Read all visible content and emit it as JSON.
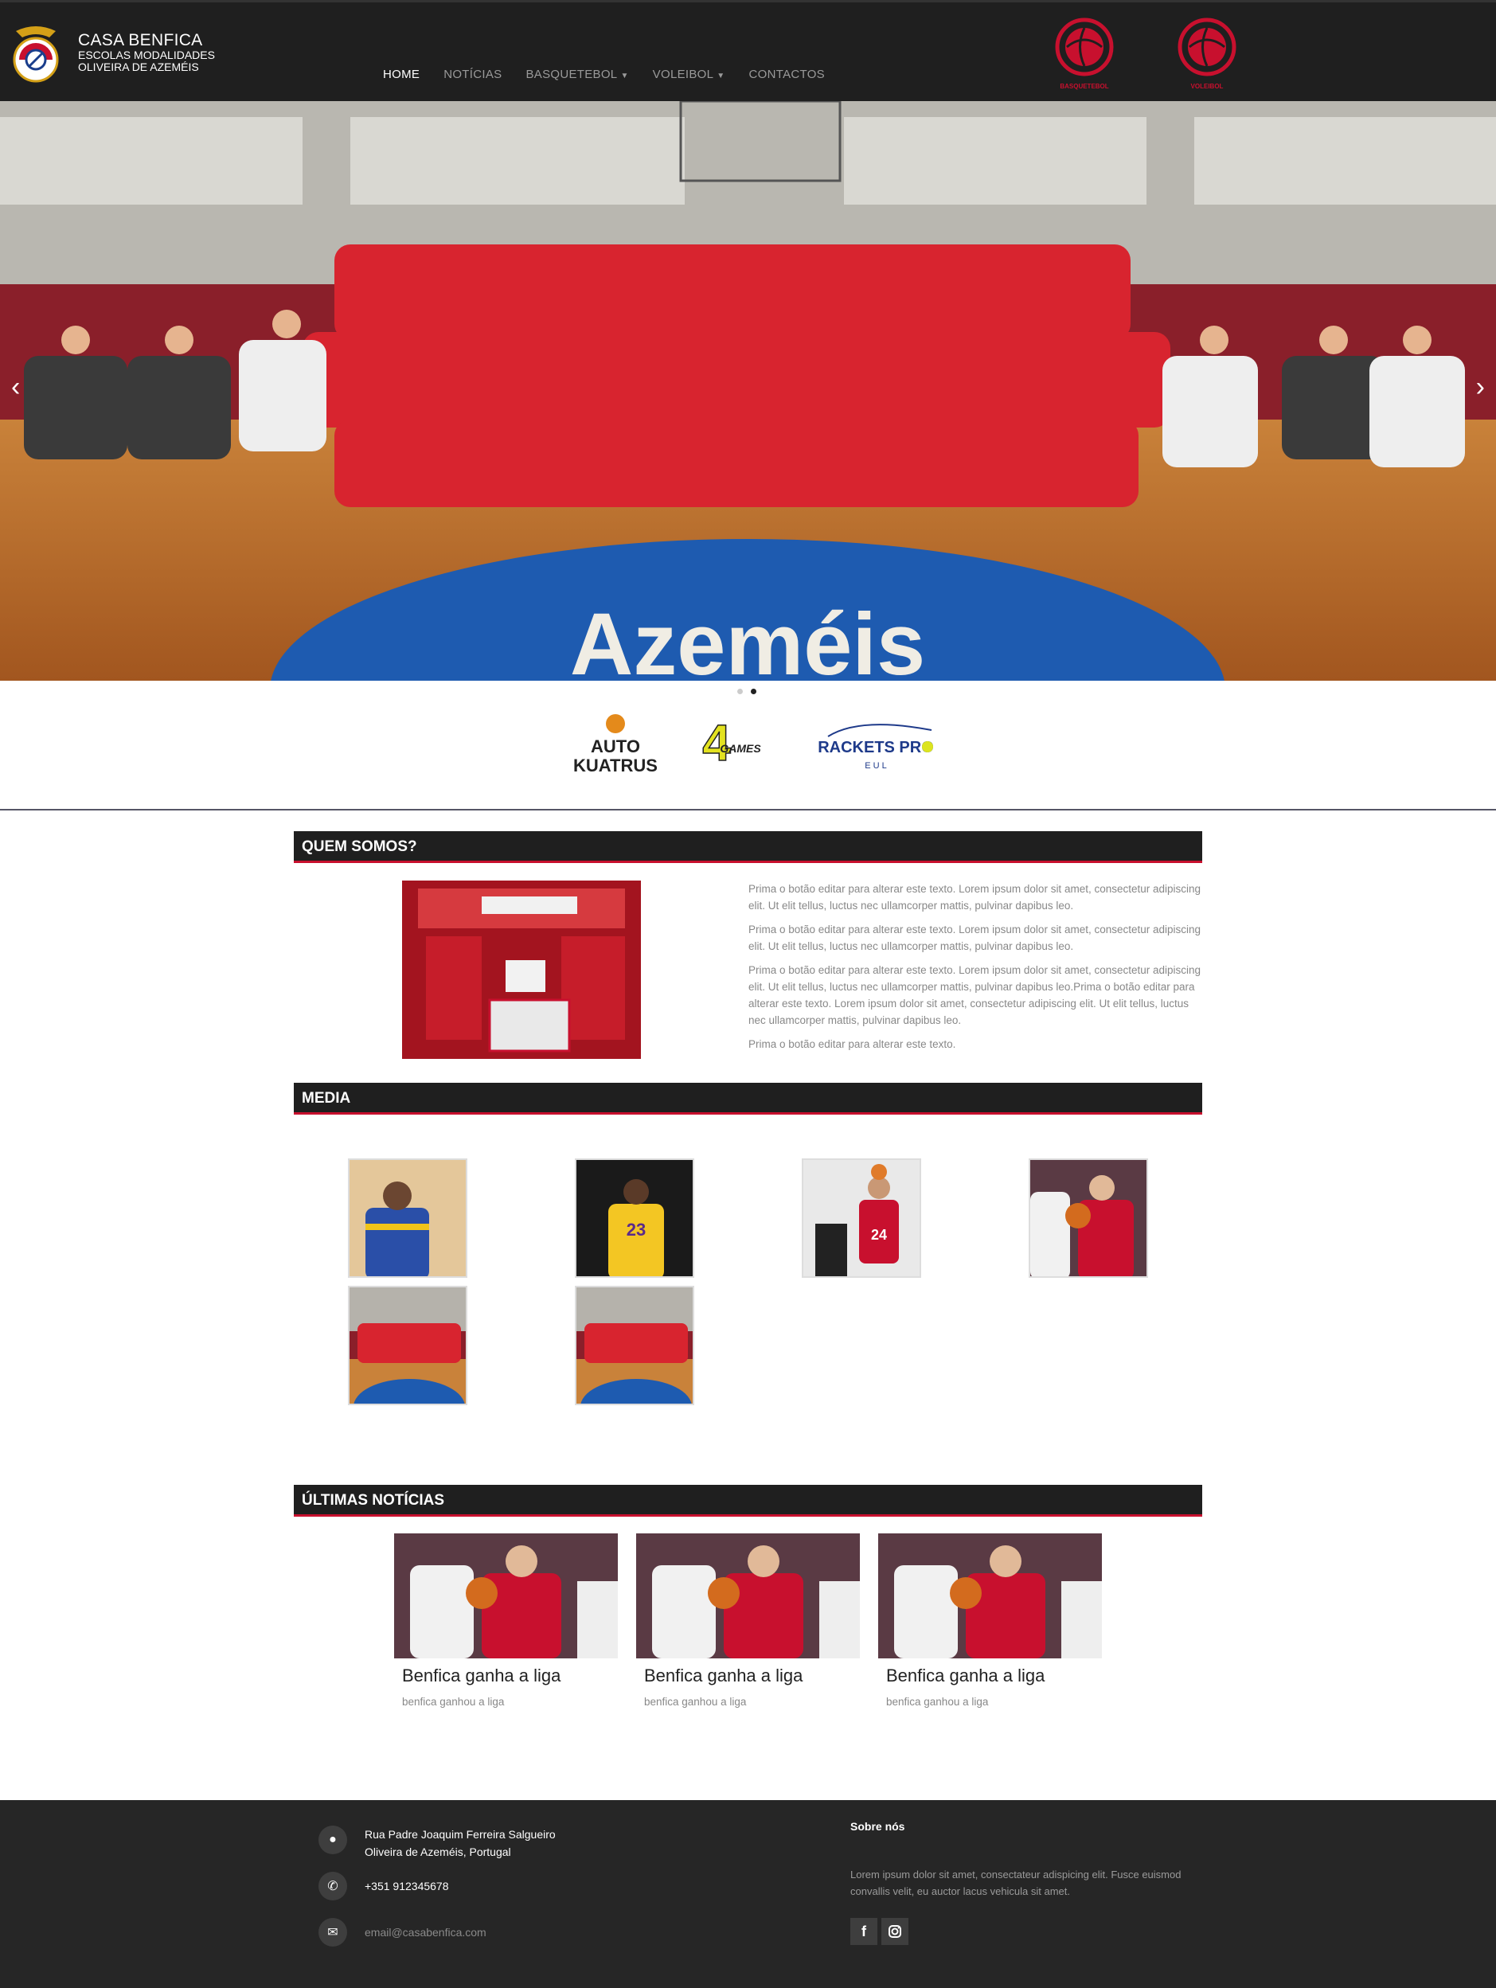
{
  "colors": {
    "nav_bg": "#1f1f1f",
    "accent": "#c8102e",
    "footer_bg": "#262626"
  },
  "brand": {
    "title": "CASA BENFICA",
    "line2": "ESCOLAS MODALIDADES",
    "line3": "OLIVEIRA DE AZEMÉIS"
  },
  "nav": {
    "items": [
      {
        "label": "HOME",
        "active": true
      },
      {
        "label": "NOTÍCIAS"
      },
      {
        "label": "BASQUETEBOL",
        "dropdown": true
      },
      {
        "label": "VOLEIBOL",
        "dropdown": true
      },
      {
        "label": "CONTACTOS"
      }
    ],
    "badges": [
      "BASQUETEBOL",
      "VOLEIBOL"
    ]
  },
  "hero": {
    "prev_icon": "chevron-left-icon",
    "next_icon": "chevron-right-icon",
    "slides": 2,
    "active_slide": 2,
    "wordmark": "Azeméis"
  },
  "sponsors": [
    {
      "line1": "AUTO",
      "line2": "KUATRUS"
    },
    {
      "line1": "4",
      "line2": "GAMES"
    },
    {
      "line1": "RACKETS PRO",
      "line2": "E U L"
    }
  ],
  "about": {
    "title": "QUEM SOMOS?",
    "paragraphs": [
      "Prima o botão editar para alterar este texto. Lorem ipsum dolor sit amet, consectetur adipiscing elit. Ut elit tellus, luctus nec ullamcorper mattis, pulvinar dapibus leo.",
      "Prima o botão editar para alterar este texto. Lorem ipsum dolor sit amet, consectetur adipiscing elit. Ut elit tellus, luctus nec ullamcorper mattis, pulvinar dapibus leo.",
      "Prima o botão editar para alterar este texto. Lorem ipsum dolor sit amet, consectetur adipiscing elit. Ut elit tellus, luctus nec ullamcorper mattis, pulvinar dapibus leo.Prima o botão editar para alterar este texto. Lorem ipsum dolor sit amet, consectetur adipiscing elit. Ut elit tellus, luctus nec ullamcorper mattis, pulvinar dapibus leo.",
      "Prima o botão editar para alterar este texto."
    ]
  },
  "media": {
    "title": "MEDIA",
    "count": 6
  },
  "news": {
    "title": "ÚLTIMAS NOTÍCIAS",
    "items": [
      {
        "title": "Benfica ganha a liga",
        "subtitle": "benfica ganhou a liga"
      },
      {
        "title": "Benfica ganha a liga",
        "subtitle": "benfica ganhou a liga"
      },
      {
        "title": "Benfica ganha a liga",
        "subtitle": "benfica ganhou a liga"
      }
    ]
  },
  "footer": {
    "address_line1": "Rua Padre Joaquim Ferreira Salgueiro",
    "address_line2": "Oliveira de Azeméis, Portugal",
    "phone": "+351 912345678",
    "email": "email@casabenfica.com",
    "about_title": "Sobre nós",
    "about_text": "Lorem ipsum dolor sit amet, consectateur adispicing elit. Fusce euismod convallis velit, eu auctor lacus vehicula sit amet.",
    "social": [
      "facebook-icon",
      "instagram-icon"
    ]
  }
}
